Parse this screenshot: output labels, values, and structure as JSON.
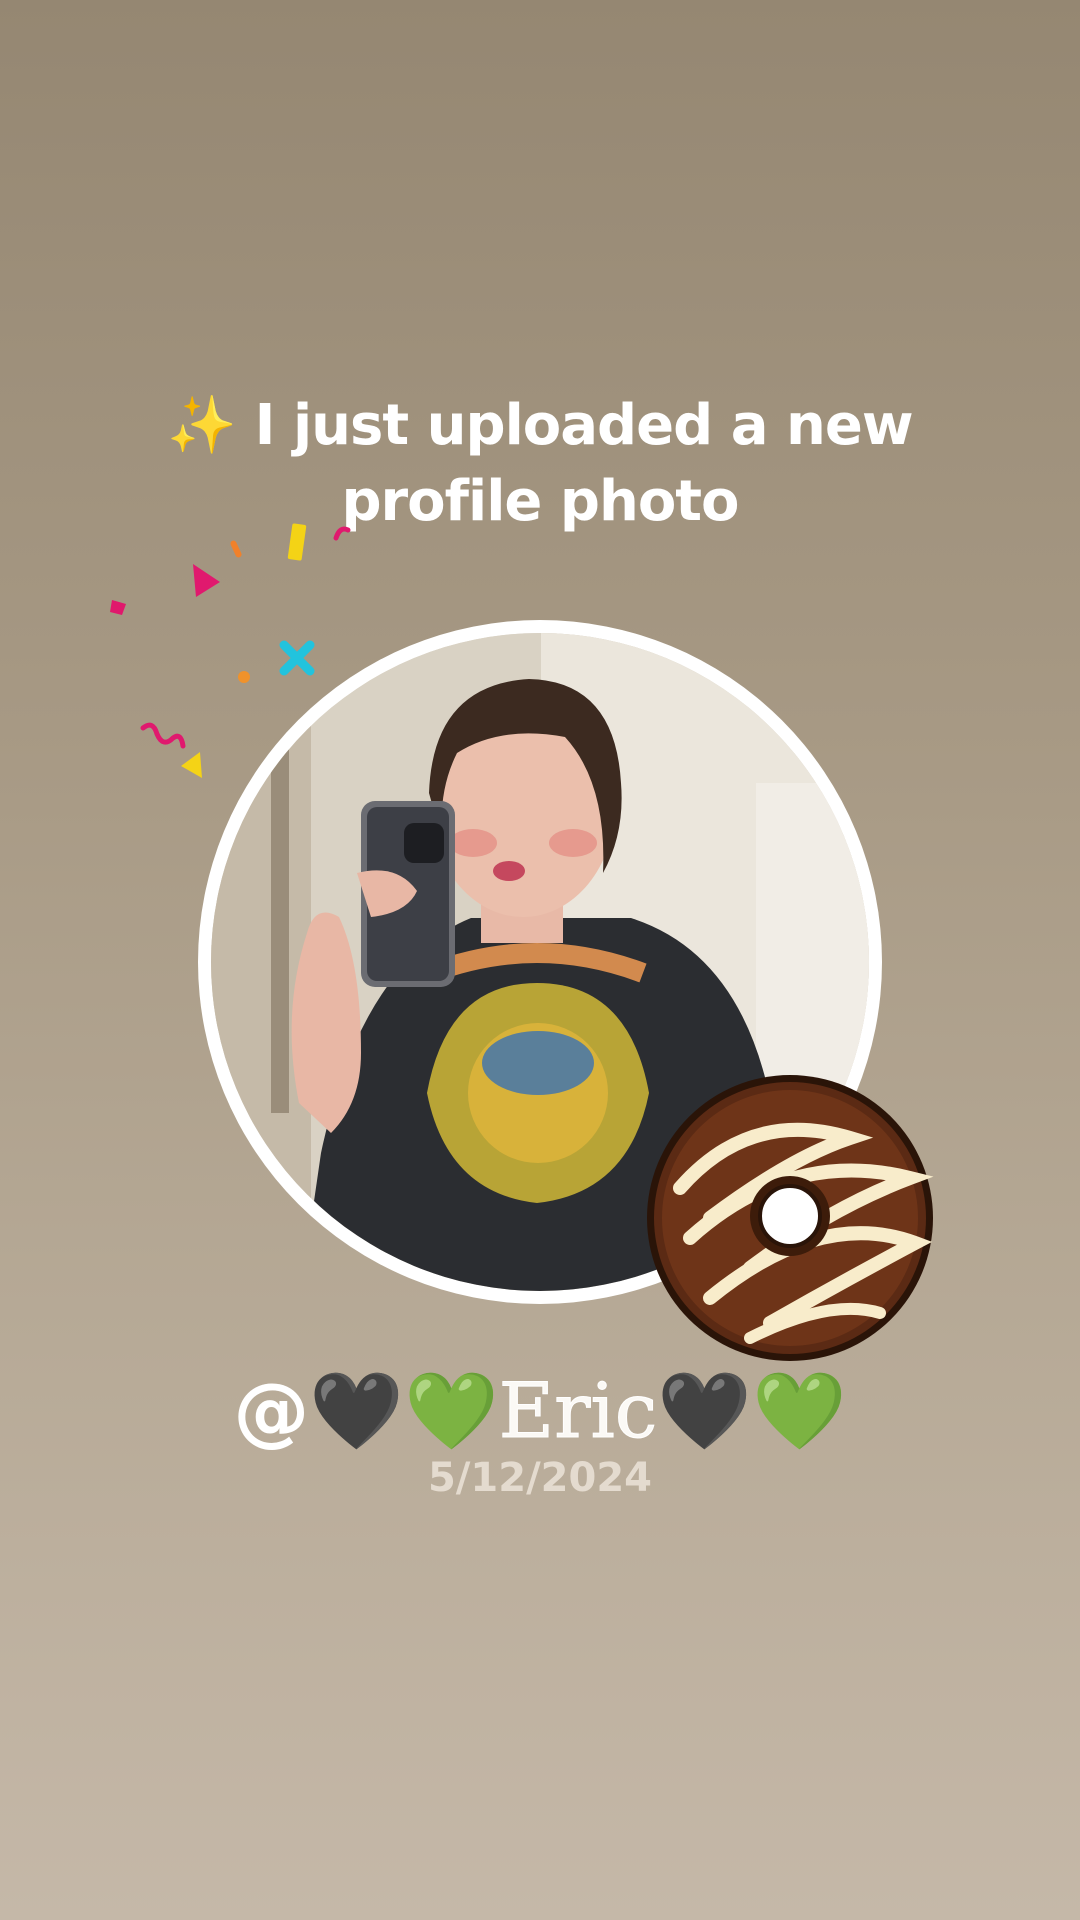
{
  "headline": {
    "sparkle_icon": "✨",
    "line1": "I just uploaded a new",
    "line2": "profile photo"
  },
  "profile": {
    "handle_at": "@",
    "heart_black": "🖤",
    "heart_green": "💚",
    "name": "Eric",
    "date": "5/12/2024"
  },
  "icons": {
    "sparkle": "sparkle-icon",
    "donut": "donut-sticker-icon",
    "confetti": "confetti-icon"
  },
  "colors": {
    "background_top": "#958772",
    "background_bottom": "#c5b8a8",
    "ring": "#ffffff",
    "text": "#ffffff",
    "date_text": "#e4dbcf"
  }
}
